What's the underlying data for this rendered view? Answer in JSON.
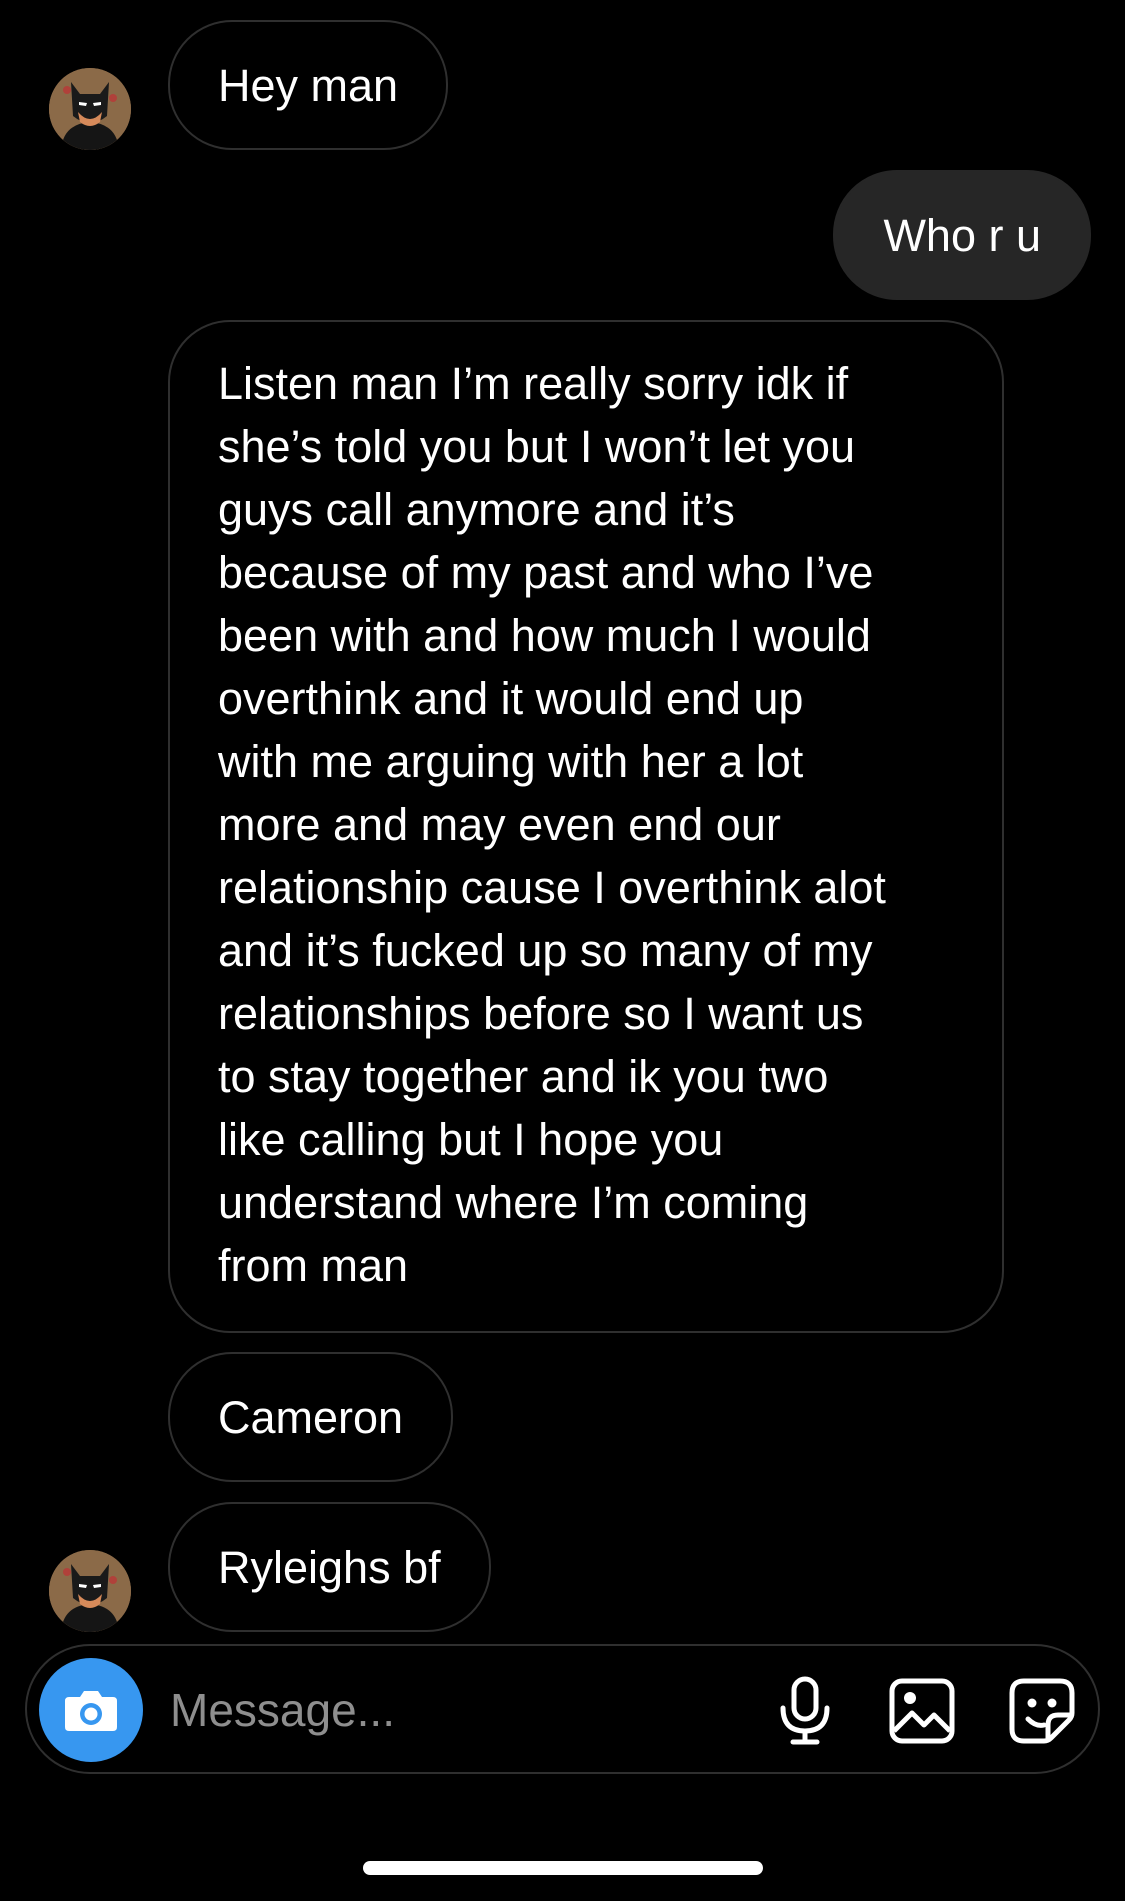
{
  "messages": [
    {
      "sender": "them",
      "text": "Hey man"
    },
    {
      "sender": "me",
      "text": "Who r u"
    },
    {
      "sender": "them",
      "lines": [
        "Listen man I’m really sorry idk if",
        "she’s told you but I won’t let you",
        "guys call anymore and it’s",
        "because of my past and who I’ve",
        "been with and how much I would",
        "overthink and it would end up",
        "with me arguing with her a lot",
        "more and may even end our",
        "relationship cause I overthink alot",
        "and it’s fucked up so many of my",
        "relationships before so I want us",
        "to stay together and ik you two",
        "like calling but I hope you",
        "understand where I’m coming",
        "from man"
      ]
    },
    {
      "sender": "them",
      "text": "Cameron"
    },
    {
      "sender": "them",
      "text": "Ryleighs bf"
    }
  ],
  "composer": {
    "placeholder": "Message...",
    "icons": [
      "camera-icon",
      "microphone-icon",
      "gallery-icon",
      "sticker-icon"
    ]
  },
  "colors": {
    "background": "#000000",
    "sent_bubble": "#262626",
    "received_border": "#2f2f2f",
    "camera_button": "#3797f0",
    "placeholder": "#8e8e8e"
  }
}
